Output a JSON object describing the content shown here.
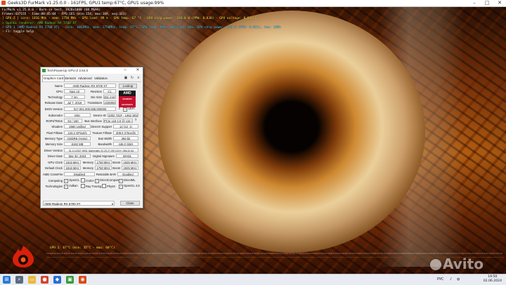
{
  "furmark": {
    "window_title": "Geeks3D FurMark v1.25.0.0 - 161FPS, GPU1 temp:67°C, GPU1 usage:99%",
    "osd": [
      {
        "text": "FurMark v1.25.0.0 - Burn-in test, 1920x1080 (8X MSAA)",
        "color": "w"
      },
      {
        "text": "Frames:437155 - time:00:45:04 - FPS:161 (min:154, max:169, avg:161)",
        "color": "w"
      },
      {
        "text": "[ GPU-Z ] core: 1016 MHz - mem: 1750 MHz - GPU load: 99 % - GPU temp: 67 °C - GPU chip power: 194.0 W (PPW: 0.830) - GPU voltage: 0.856 V",
        "color": "y"
      },
      {
        "text": "> OpenGL renderer: AMD Radeon RX 5700 XT",
        "color": "g"
      },
      {
        "text": "> GPU 1 (AMD Radeon RX 5700 XT) - core: 1042MHz, mem: 1750MHz, temp: 67°C, GPU load: 99%, mem load: 64%, GPU chip power: 196 W (PPW: 0.821), fan: 100%",
        "color": "c"
      },
      {
        "text": "- F1: toggle help",
        "color": "w"
      }
    ],
    "graph_label": "GPU 1: 67°C (min: 35°C - max: 68°C)",
    "watermark": "Avito"
  },
  "gpuz": {
    "title": "TechPowerUp GPU-Z 2.54.0",
    "tabs": [
      "Graphics Card",
      "Sensors",
      "Advanced",
      "Validation"
    ],
    "fields": {
      "name_label": "Name",
      "name": "AMD Radeon RX 5700 XT",
      "lookup": "Lookup",
      "gpu_label": "GPU",
      "gpu": "Navi 10",
      "revision_label": "Revision",
      "revision": "C1",
      "technology_label": "Technology",
      "technology": "7 nm",
      "die_size_label": "Die Size",
      "die_size": "251 mm²",
      "release_date_label": "Release Date",
      "release_date": "Jul 7, 2019",
      "transistors_label": "Transistors",
      "transistors": "10300M",
      "bios_label": "BIOS Version",
      "bios": "017.001.000.068.000000",
      "uefi": "UEFI",
      "subvendor_label": "Subvendor",
      "subvendor": "MSI",
      "device_id_label": "Device ID",
      "device_id": "1002 731F - 1462 3810",
      "rops_label": "ROPs/TMUs",
      "rops": "64 / 160",
      "bus_interface_label": "Bus Interface",
      "bus_interface": "PCIe x16 4.0 @ x16 4.0",
      "shaders_label": "Shaders",
      "shaders": "2560 Unified",
      "directx_label": "DirectX Support",
      "directx": "12 (12_1)",
      "pixel_fillrate_label": "Pixel Fillrate",
      "pixel_fillrate": "123.2 GPixel/s",
      "texture_fillrate_label": "Texture Fillrate",
      "texture_fillrate": "308.0 GTexel/s",
      "memory_type_label": "Memory Type",
      "memory_type": "GDDR6 (Hynix)",
      "bus_width_label": "Bus Width",
      "bus_width": "256 bit",
      "memory_size_label": "Memory Size",
      "memory_size": "8192 MB",
      "bandwidth_label": "Bandwidth",
      "bandwidth": "448.0 GB/s",
      "driver_version_label": "Driver Version",
      "driver_version": "31.0.12027.9001 (Adrenalin 22.20.27.09) DCH / Win10 64",
      "driver_date_label": "Driver Date",
      "driver_date": "Mar 30, 2023",
      "digital_signature_label": "Digital Signature",
      "digital_signature": "WHQL",
      "gpu_clock_label": "GPU Clock",
      "gpu_clock": "1815 MHz",
      "memory_clock_label": "Memory",
      "memory_clock": "1750 MHz",
      "boost_label": "Boost",
      "boost": "1925 MHz",
      "default_clock_label": "Default Clock",
      "default_clock": "1815 MHz",
      "default_memory_label": "Memory",
      "default_memory": "1750 MHz",
      "default_boost_label": "Boost",
      "default_boost": "1925 MHz",
      "crossfire_label": "AMD CrossFire",
      "crossfire": "Disabled",
      "resizable_bar_label": "Resizable BAR",
      "resizable_bar": "Enabled",
      "computing_label": "Computing",
      "technologies_label": "Technologies"
    },
    "computing": [
      {
        "label": "OpenCL",
        "checked": true
      },
      {
        "label": "CUDA",
        "checked": false
      },
      {
        "label": "DirectCompute",
        "checked": true
      },
      {
        "label": "DirectML",
        "checked": true
      }
    ],
    "technologies": [
      {
        "label": "Vulkan",
        "checked": true
      },
      {
        "label": "Ray Tracing",
        "checked": false
      },
      {
        "label": "PhysX",
        "checked": false
      },
      {
        "label": "OpenGL 4.6",
        "checked": true
      }
    ],
    "logo": {
      "brand": "AMD",
      "sub": "RADEON GRAPHICS"
    },
    "selected_gpu": "AMD Radeon RX 5700 XT",
    "close_label": "Close"
  },
  "taskbar": {
    "time": "19:50",
    "date": "02.06.2024",
    "lang": "РУС"
  },
  "colors": {
    "osd_white": "#ffffff",
    "osd_yellow": "#ffe24a",
    "osd_green": "#52e24a",
    "osd_cyan": "#46d6ff"
  }
}
